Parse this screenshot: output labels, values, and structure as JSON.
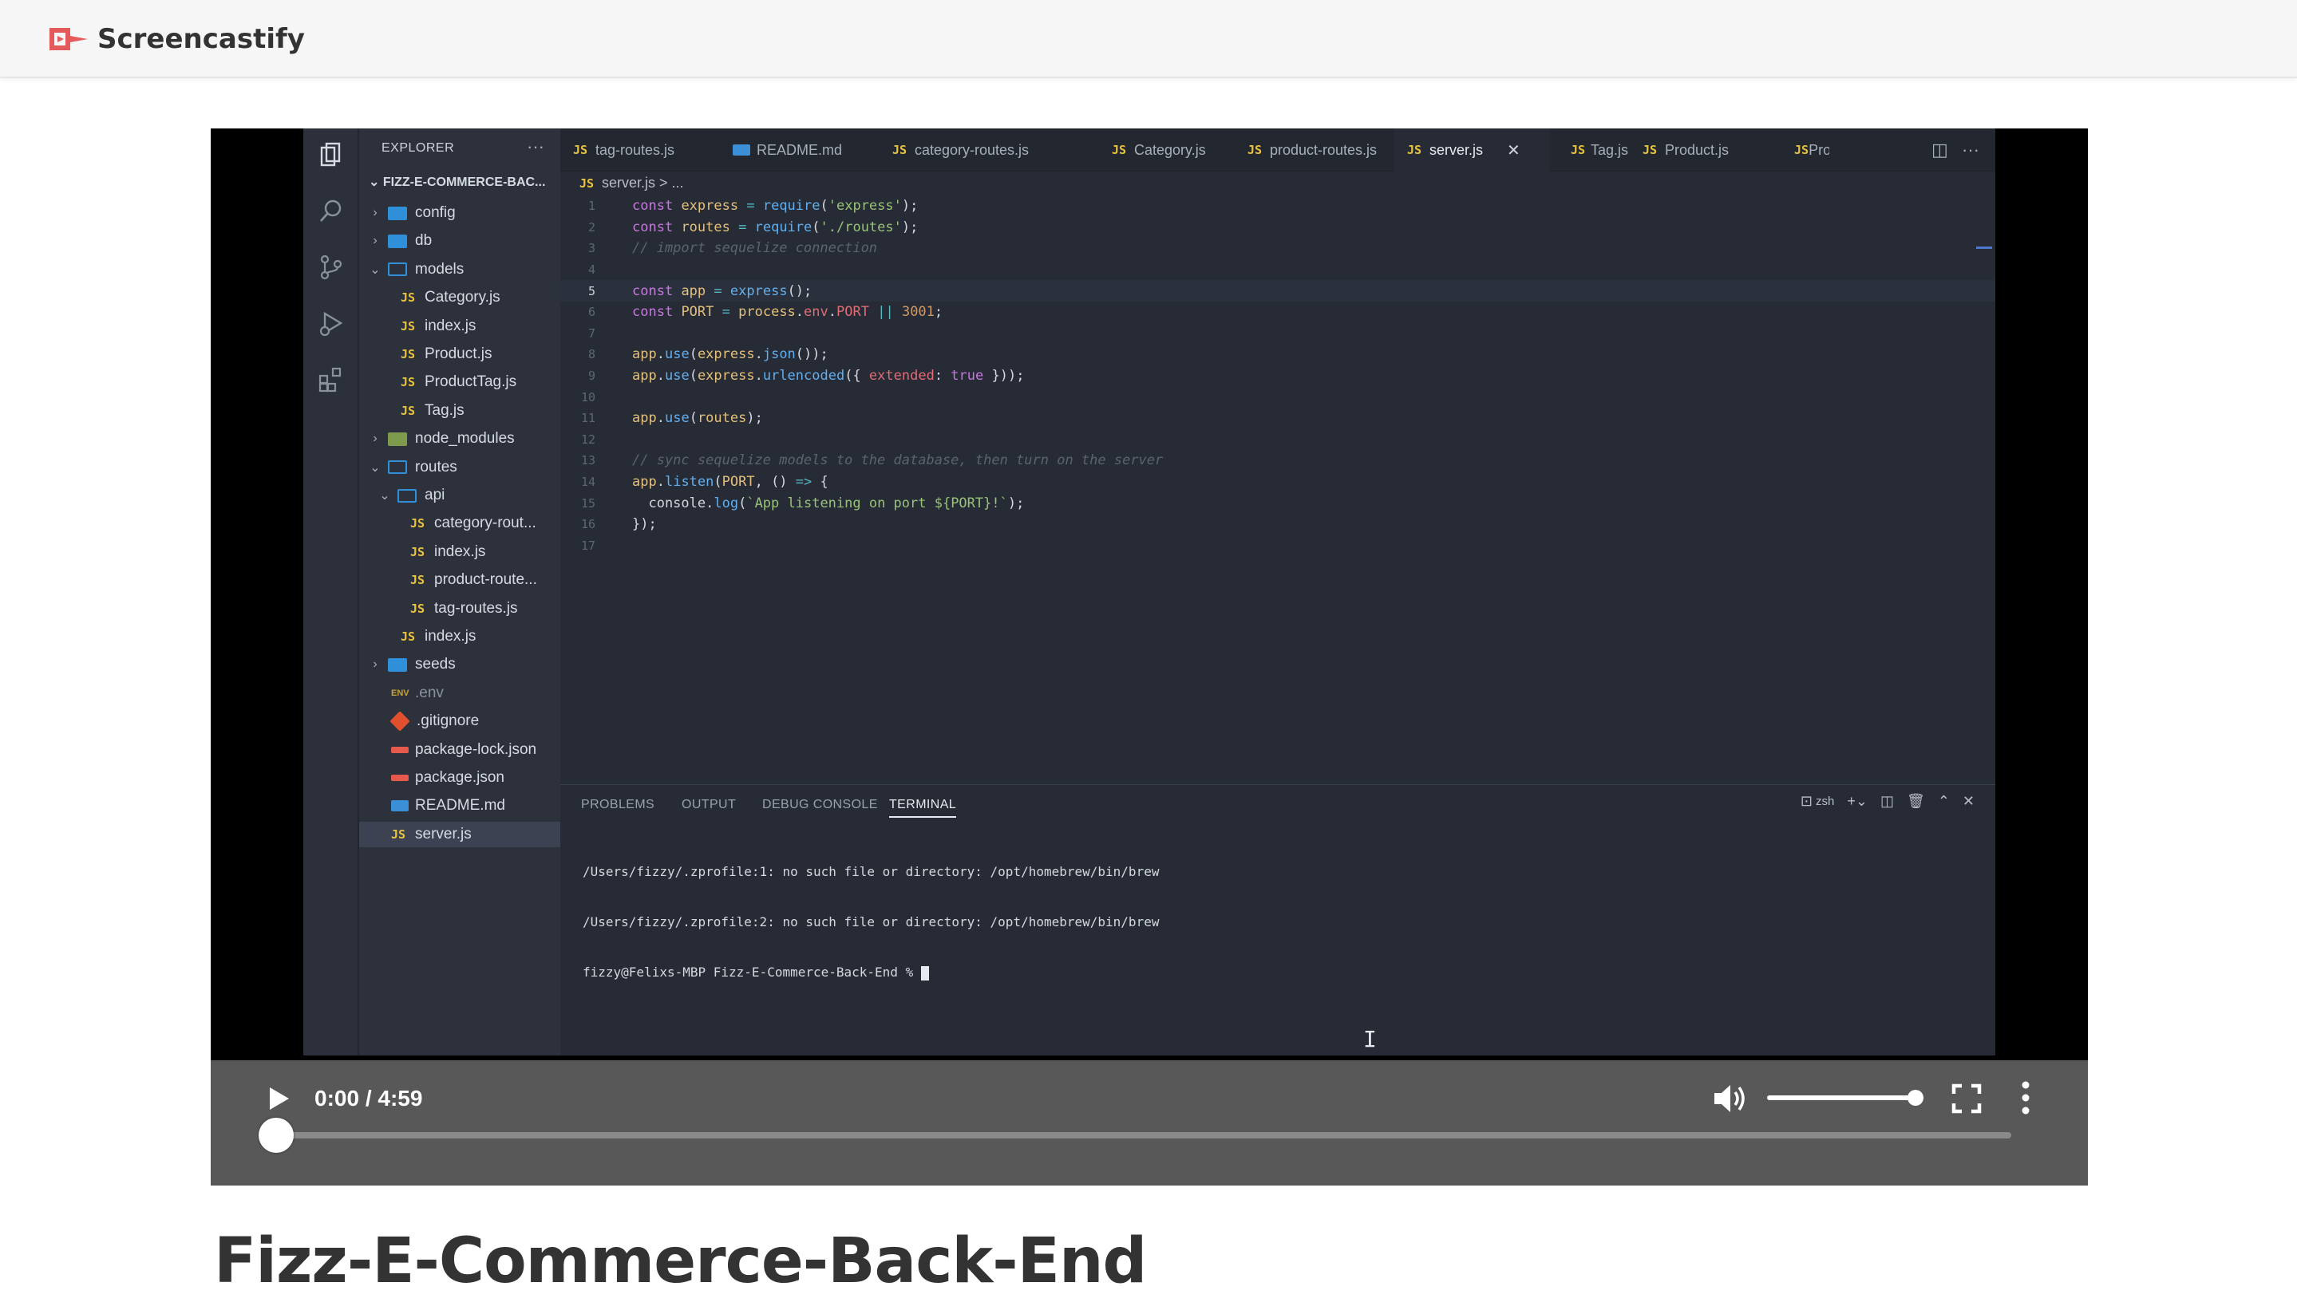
{
  "app": {
    "brand_name": "Screencastify",
    "brand_color": "#e55a5a"
  },
  "video": {
    "title": "Fizz-E-Commerce-Back-End",
    "time_display": "0:00 / 4:59",
    "current_time": "0:00",
    "duration": "4:59",
    "progress_fraction": 0,
    "volume_fraction": 1.0,
    "controls": {
      "play": "play-icon",
      "volume": "volume-icon",
      "fullscreen": "fullscreen-icon",
      "more": "more-options-icon"
    }
  },
  "vscode": {
    "explorer": {
      "header": "EXPLORER",
      "root": "FIZZ-E-COMMERCE-BAC...",
      "items": [
        {
          "label": "config",
          "kind": "folder",
          "state": "closed",
          "depth": 1
        },
        {
          "label": "db",
          "kind": "folder",
          "state": "closed",
          "depth": 1
        },
        {
          "label": "models",
          "kind": "folder",
          "state": "open",
          "depth": 1
        },
        {
          "label": "Category.js",
          "kind": "js",
          "depth": 2
        },
        {
          "label": "index.js",
          "kind": "js",
          "depth": 2
        },
        {
          "label": "Product.js",
          "kind": "js",
          "depth": 2
        },
        {
          "label": "ProductTag.js",
          "kind": "js",
          "depth": 2
        },
        {
          "label": "Tag.js",
          "kind": "js",
          "depth": 2
        },
        {
          "label": "node_modules",
          "kind": "nm",
          "state": "closed",
          "depth": 1
        },
        {
          "label": "routes",
          "kind": "folder",
          "state": "open",
          "depth": 1
        },
        {
          "label": "api",
          "kind": "folder",
          "state": "open",
          "depth": 2
        },
        {
          "label": "category-rout...",
          "kind": "js",
          "depth": 3
        },
        {
          "label": "index.js",
          "kind": "js",
          "depth": 3
        },
        {
          "label": "product-route...",
          "kind": "js",
          "depth": 3
        },
        {
          "label": "tag-routes.js",
          "kind": "js",
          "depth": 3
        },
        {
          "label": "index.js",
          "kind": "js",
          "depth": 2
        },
        {
          "label": "seeds",
          "kind": "folder",
          "state": "closed",
          "depth": 1
        },
        {
          "label": ".env",
          "kind": "env",
          "depth": 1
        },
        {
          "label": ".gitignore",
          "kind": "git",
          "depth": 1
        },
        {
          "label": "package-lock.json",
          "kind": "json",
          "depth": 1
        },
        {
          "label": "package.json",
          "kind": "json",
          "depth": 1
        },
        {
          "label": "README.md",
          "kind": "md",
          "depth": 1
        },
        {
          "label": "server.js",
          "kind": "js",
          "depth": 1,
          "active": true
        }
      ]
    },
    "tabs": [
      {
        "label": "tag-routes.js",
        "kind": "js"
      },
      {
        "label": "README.md",
        "kind": "md"
      },
      {
        "label": "category-routes.js",
        "kind": "js"
      },
      {
        "label": "Category.js",
        "kind": "js"
      },
      {
        "label": "product-routes.js",
        "kind": "js"
      },
      {
        "label": "server.js",
        "kind": "js",
        "active": true
      },
      {
        "label": "Tag.js",
        "kind": "js"
      },
      {
        "label": "Product.js",
        "kind": "js"
      },
      {
        "label": "Pro",
        "kind": "js"
      }
    ],
    "breadcrumb": {
      "file": "server.js",
      "rest": "> ..."
    },
    "code_lines": [
      "const express = require('express');",
      "const routes = require('./routes');",
      "// import sequelize connection",
      "",
      "const app = express();",
      "const PORT = process.env.PORT || 3001;",
      "",
      "app.use(express.json());",
      "app.use(express.urlencoded({ extended: true }));",
      "",
      "app.use(routes);",
      "",
      "// sync sequelize models to the database, then turn on the server",
      "app.listen(PORT, () => {",
      "  console.log(`App listening on port ${PORT}!`);",
      "});",
      ""
    ],
    "current_line": 5,
    "panel": {
      "tabs": [
        "PROBLEMS",
        "OUTPUT",
        "DEBUG CONSOLE",
        "TERMINAL"
      ],
      "active_tab": "TERMINAL",
      "shell": "zsh",
      "terminal_lines": [
        "/Users/fizzy/.zprofile:1: no such file or directory: /opt/homebrew/bin/brew",
        "/Users/fizzy/.zprofile:2: no such file or directory: /opt/homebrew/bin/brew",
        "fizzy@Felixs-MBP Fizz-E-Commerce-Back-End % "
      ]
    }
  }
}
